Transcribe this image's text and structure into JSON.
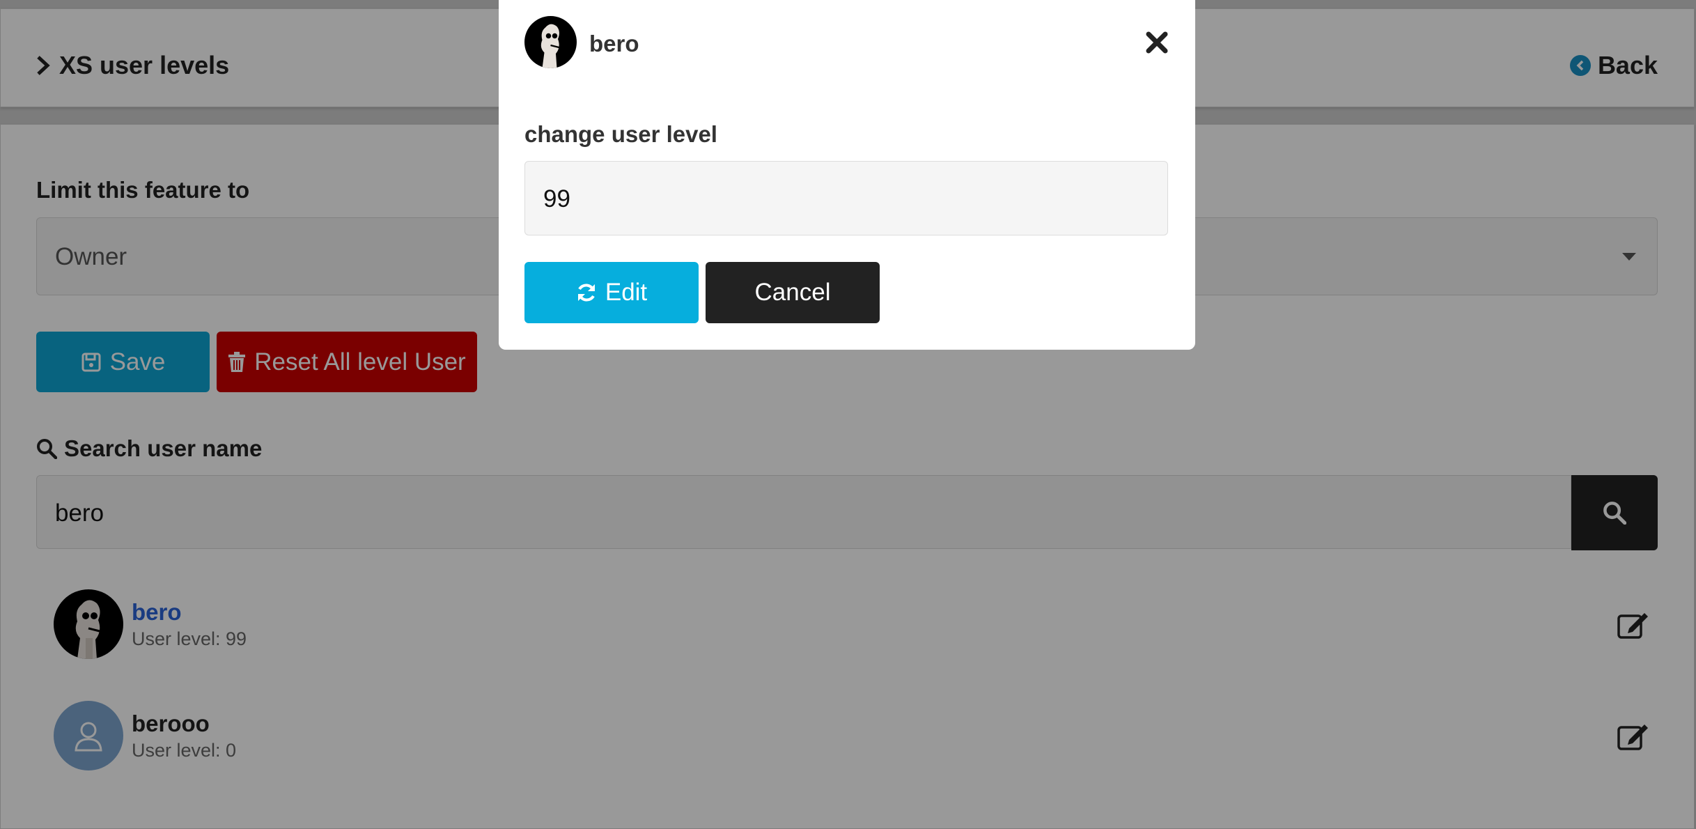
{
  "header": {
    "title": "XS user levels",
    "back_label": "Back"
  },
  "feature_limit": {
    "label": "Limit this feature to",
    "selected": "Owner"
  },
  "actions": {
    "save_label": "Save",
    "reset_label": "Reset All level User"
  },
  "search": {
    "label": "Search user name",
    "value": "bero"
  },
  "users": [
    {
      "name": "bero",
      "level_text": "User level: 99"
    },
    {
      "name": "berooo",
      "level_text": "User level: 0"
    }
  ],
  "modal": {
    "username": "bero",
    "field_label": "change user level",
    "field_value": "99",
    "edit_label": "Edit",
    "cancel_label": "Cancel"
  },
  "colors": {
    "primary": "#06aedd",
    "danger": "#cc0000",
    "dark": "#222222",
    "link": "#2a63d8"
  },
  "icons": [
    "chevron-right-icon",
    "back-arrow-icon",
    "save-icon",
    "trash-icon",
    "search-icon",
    "edit-icon",
    "close-icon",
    "refresh-icon",
    "user-icon"
  ]
}
